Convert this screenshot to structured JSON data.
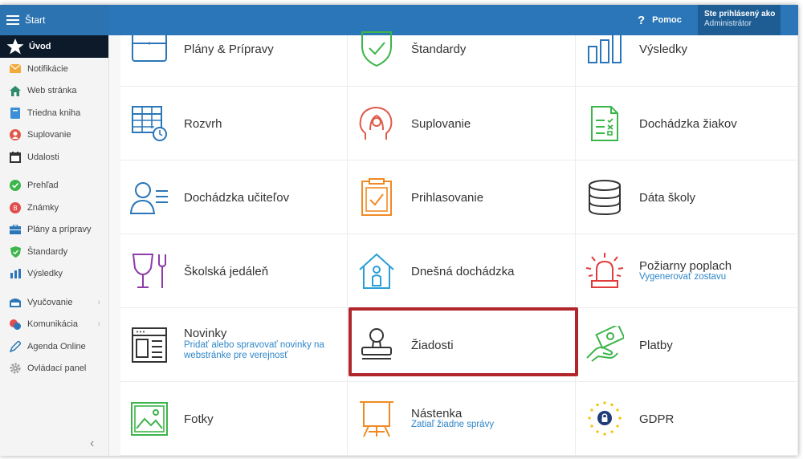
{
  "topbar": {
    "start_label": "Štart",
    "help_label": "Pomoc",
    "user_line1": "Ste prihlásený ako",
    "user_line2": "Administrátor"
  },
  "sidebar": {
    "items": [
      {
        "label": "Úvod",
        "icon": "star-icon"
      },
      {
        "label": "Notifikácie",
        "icon": "envelope-icon"
      },
      {
        "label": "Web stránka",
        "icon": "home-icon"
      },
      {
        "label": "Triedna kniha",
        "icon": "book-icon"
      },
      {
        "label": "Suplovanie",
        "icon": "person-icon"
      },
      {
        "label": "Udalosti",
        "icon": "calendar-icon"
      },
      {
        "label": "Prehľad",
        "icon": "check-circle-icon"
      },
      {
        "label": "Známky",
        "icon": "grade-icon"
      },
      {
        "label": "Plány a prípravy",
        "icon": "briefcase-icon"
      },
      {
        "label": "Štandardy",
        "icon": "shield-icon"
      },
      {
        "label": "Výsledky",
        "icon": "bar-chart-icon"
      },
      {
        "label": "Vyučovanie",
        "icon": "board-icon"
      },
      {
        "label": "Komunikácia",
        "icon": "chat-icon"
      },
      {
        "label": "Agenda Online",
        "icon": "pen-icon"
      },
      {
        "label": "Ovládací panel",
        "icon": "cog-icon"
      }
    ]
  },
  "tiles": {
    "row0": [
      {
        "title": "Plány & Prípravy"
      },
      {
        "title": "Štandardy"
      },
      {
        "title": "Výsledky"
      }
    ],
    "row1": [
      {
        "title": "Rozvrh"
      },
      {
        "title": "Suplovanie"
      },
      {
        "title": "Dochádzka žiakov"
      }
    ],
    "row2": [
      {
        "title": "Dochádzka učiteľov"
      },
      {
        "title": "Prihlasovanie"
      },
      {
        "title": "Dáta školy"
      }
    ],
    "row3": [
      {
        "title": "Školská jedáleň"
      },
      {
        "title": "Dnešná dochádzka"
      },
      {
        "title": "Požiarny poplach",
        "sub": "Vygenerovať zostavu"
      }
    ],
    "row4": [
      {
        "title": "Novinky",
        "sub": "Pridať alebo spravovať novinky na webstránke pre verejnosť"
      },
      {
        "title": "Žiadosti"
      },
      {
        "title": "Platby"
      }
    ],
    "row5": [
      {
        "title": "Fotky"
      },
      {
        "title": "Nástenka",
        "sub": "Zatiaľ žiadne správy"
      },
      {
        "title": "GDPR"
      }
    ]
  },
  "colors": {
    "topbar": "#2a76b8",
    "sidebar_active": "#0d1a2a",
    "highlight": "#b0262b",
    "link": "#2f86c8"
  }
}
